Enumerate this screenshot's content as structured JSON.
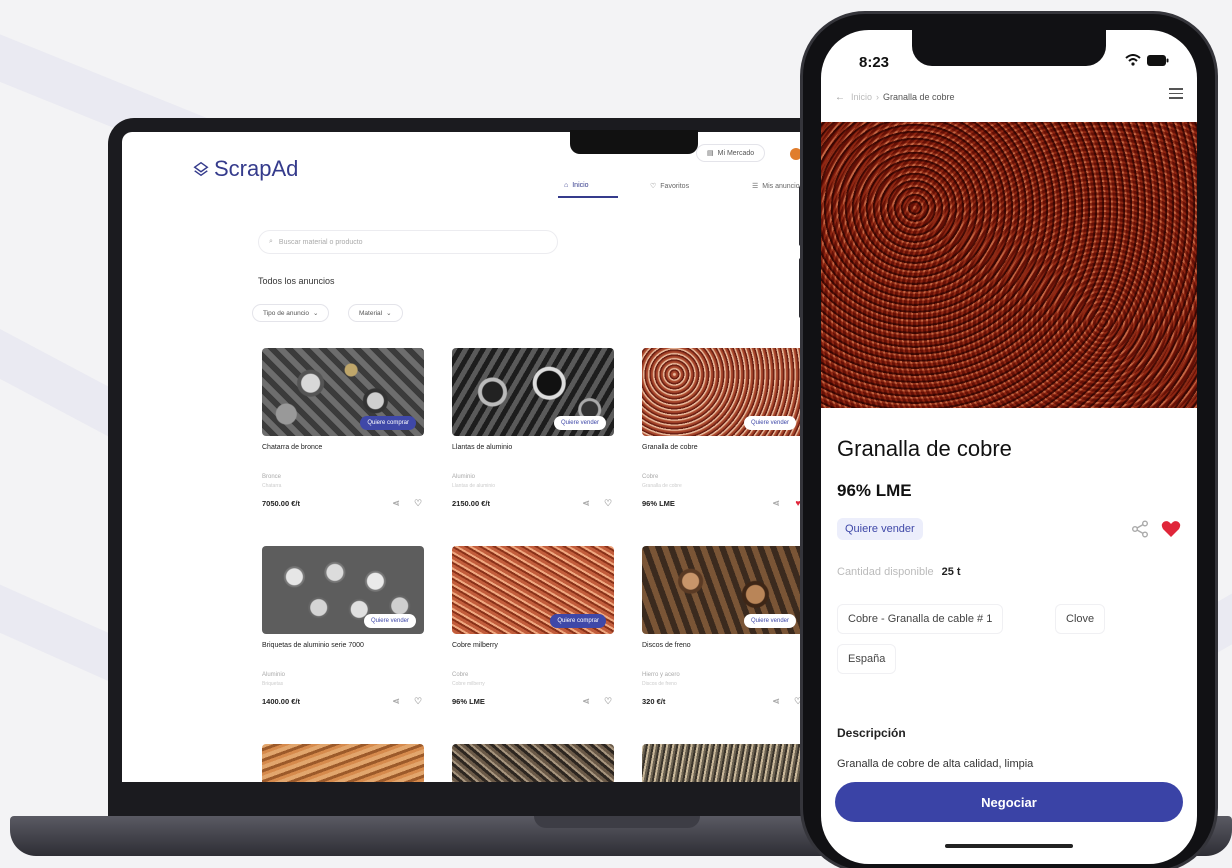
{
  "desktop": {
    "logo_text": "ScrapAd",
    "top_button_label": "Mi Mercado",
    "nav_tabs": [
      {
        "label": "Inicio",
        "icon": "home-icon"
      },
      {
        "label": "Favoritos",
        "icon": "heart-icon"
      },
      {
        "label": "Mis anuncios",
        "icon": "list-icon"
      }
    ],
    "search_placeholder": "Buscar material o producto",
    "section_title": "Todos los anuncios",
    "filters": [
      "Tipo de anuncio",
      "Material"
    ],
    "cards": [
      {
        "title": "Chatarra de bronce",
        "badge": "Quiere comprar",
        "badge_type": "buy",
        "material": "Bronce",
        "detail": "Chatarra",
        "price": "7050.00 €/t",
        "liked": false,
        "texture": "nuts"
      },
      {
        "title": "Llantas de aluminio",
        "badge": "Quiere vender",
        "badge_type": "sell",
        "material": "Aluminio",
        "detail": "Llantas de aluminio",
        "price": "2150.00 €/t",
        "liked": false,
        "texture": "alu"
      },
      {
        "title": "Granalla de cobre",
        "badge": "Quiere vender",
        "badge_type": "sell",
        "material": "Cobre",
        "detail": "Granalla de cobre",
        "price": "96% LME",
        "liked": true,
        "texture": "copper"
      },
      {
        "title": "Briquetas de aluminio serie 7000",
        "badge": "Quiere vender",
        "badge_type": "sell",
        "material": "Aluminio",
        "detail": "Briquetas",
        "price": "1400.00 €/t",
        "liked": false,
        "texture": "briq"
      },
      {
        "title": "Cobre milberry",
        "badge": "Quiere comprar",
        "badge_type": "buy",
        "material": "Cobre",
        "detail": "Cobre milberry",
        "price": "96% LME",
        "liked": false,
        "texture": "wire"
      },
      {
        "title": "Discos de freno",
        "badge": "Quiere vender",
        "badge_type": "sell",
        "material": "Hierro y acero",
        "detail": "Discos de freno",
        "price": "320 €/t",
        "liked": false,
        "texture": "brakes"
      },
      {
        "title": "",
        "badge": "",
        "badge_type": "",
        "material": "",
        "detail": "",
        "price": "",
        "liked": false,
        "texture": "wood"
      },
      {
        "title": "",
        "badge": "",
        "badge_type": "",
        "material": "",
        "detail": "",
        "price": "",
        "liked": false,
        "texture": "mix"
      },
      {
        "title": "",
        "badge": "",
        "badge_type": "",
        "material": "",
        "detail": "",
        "price": "",
        "liked": false,
        "texture": "rods"
      }
    ]
  },
  "phone": {
    "time": "8:23",
    "breadcrumb_parent": "Inicio",
    "breadcrumb_current": "Granalla de cobre",
    "title": "Granalla de cobre",
    "price": "96% LME",
    "badge": "Quiere vender",
    "quantity_label": "Cantidad disponible",
    "quantity_value": "25 t",
    "chips": [
      "Cobre - Granalla de cable # 1",
      "Clove",
      "España"
    ],
    "description_title": "Descripción",
    "description_text": "Granalla de cobre de alta calidad, limpia",
    "cta_label": "Negociar",
    "liked": true
  },
  "colors": {
    "brand": "#353b8c",
    "cta": "#3a43a6",
    "heart": "#e0263a",
    "accent_orange": "#e07d2d"
  }
}
